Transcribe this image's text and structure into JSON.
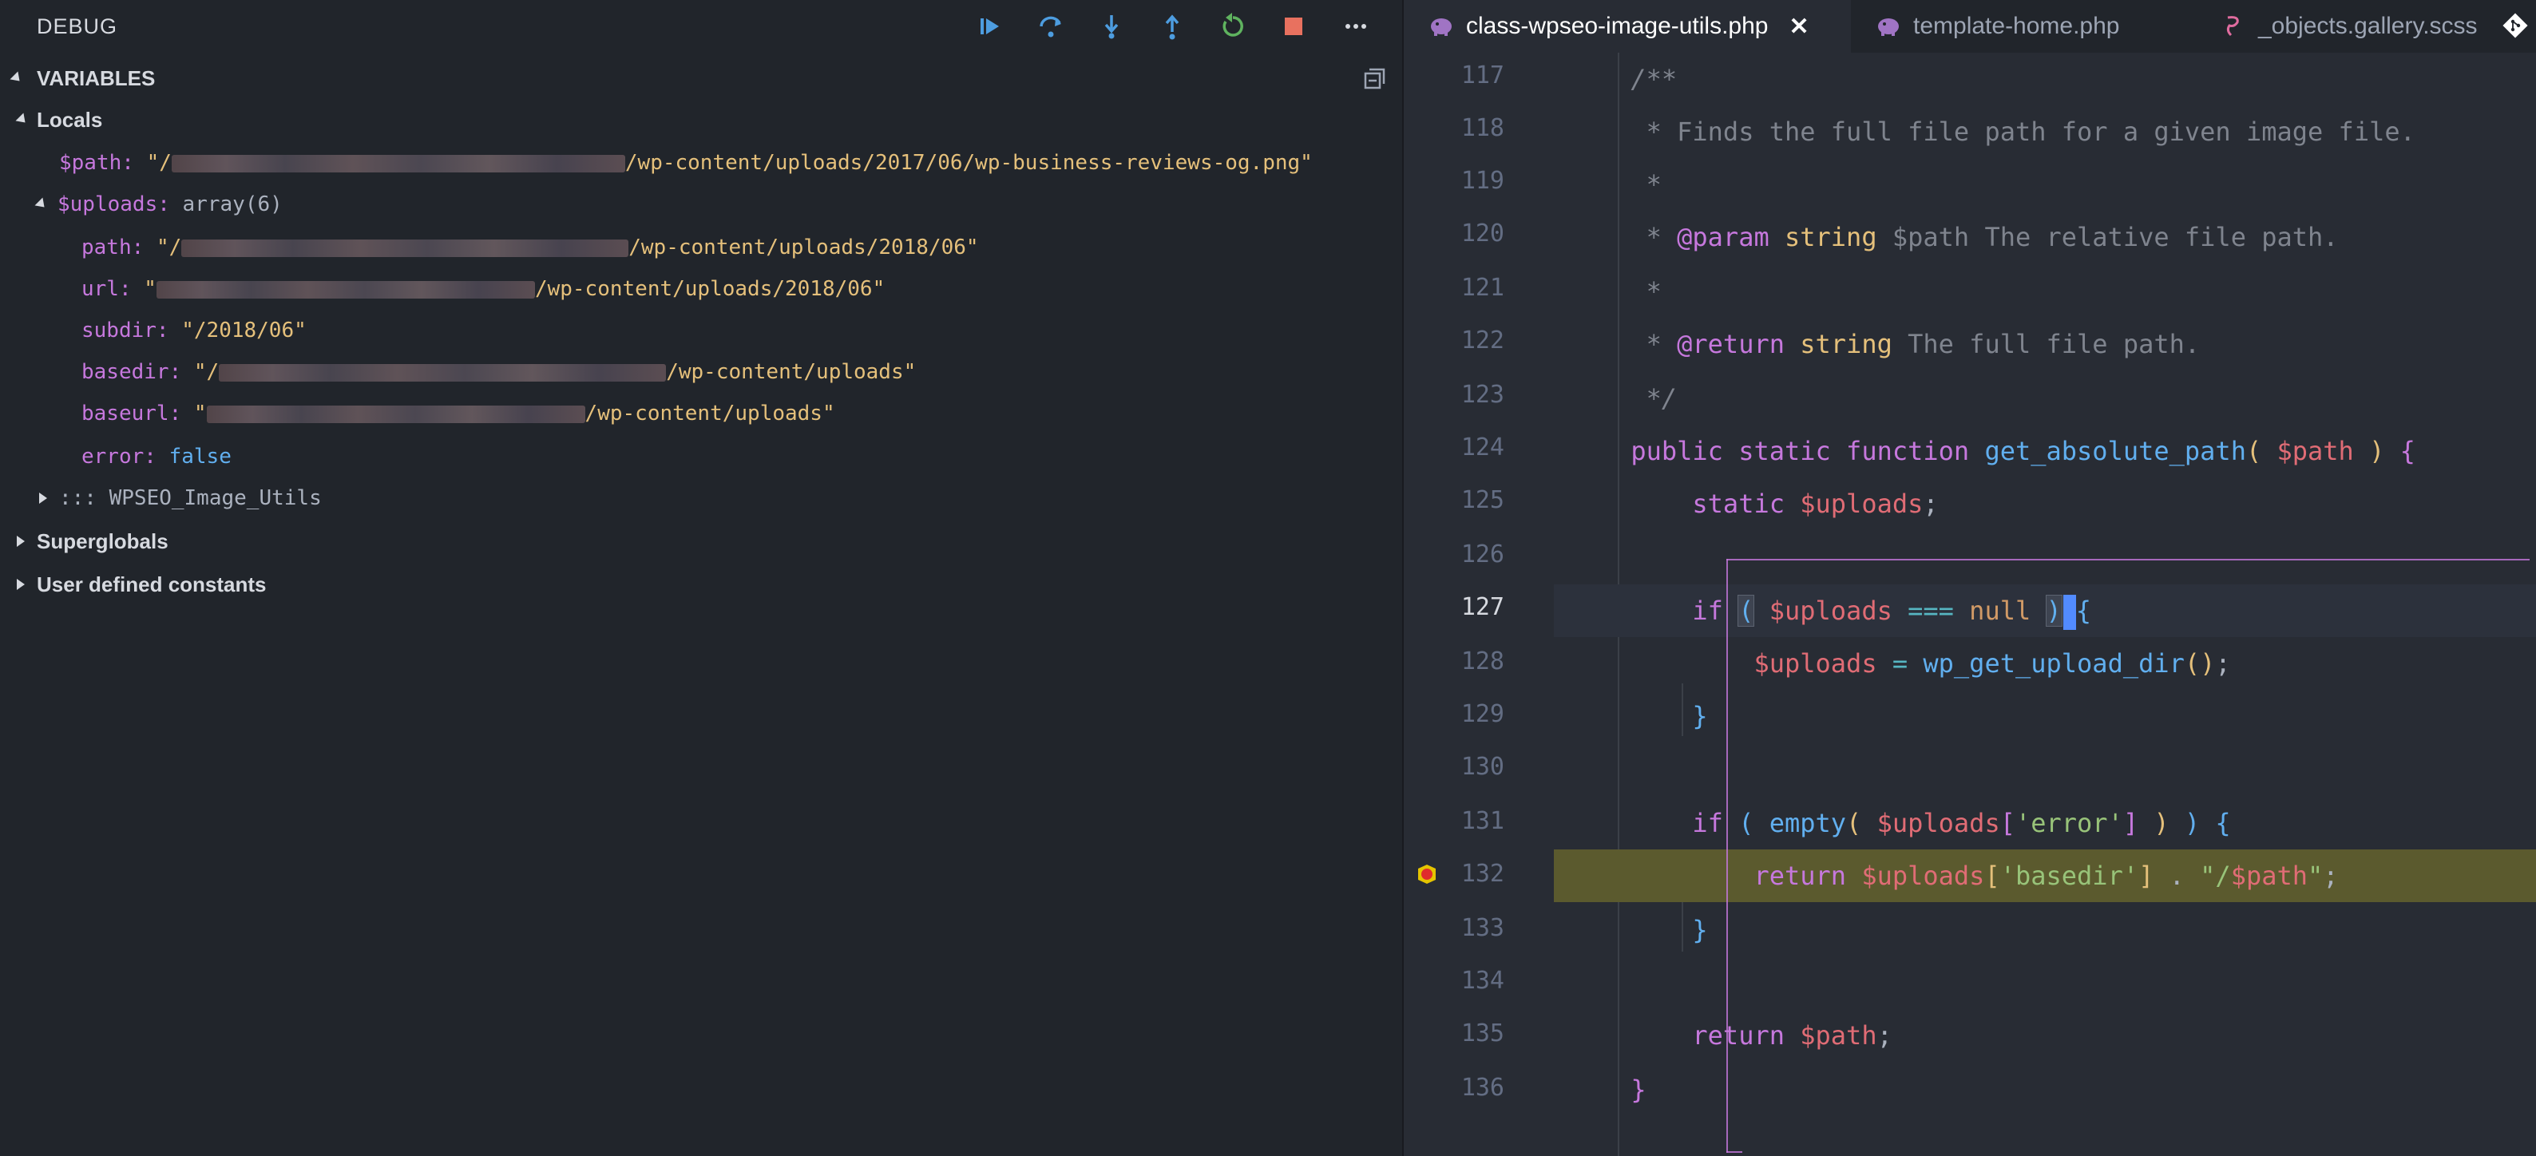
{
  "debug": {
    "title": "DEBUG",
    "toolbar_icons": [
      "continue-icon",
      "step-over-icon",
      "step-into-icon",
      "step-out-icon",
      "restart-icon",
      "stop-icon",
      "more-icon"
    ],
    "colors": {
      "continue": "#4d9de0",
      "step": "#4d9de0",
      "restart": "#5fb35f",
      "stop": "#e8715f"
    }
  },
  "variables": {
    "header": "VARIABLES",
    "locals_label": "Locals",
    "path_name": "$path:",
    "path_value_prefix": "\"/",
    "path_value_suffix": "/wp-content/uploads/2017/06/wp-business-reviews-og.png\"",
    "uploads_name": "$uploads:",
    "uploads_value": "array(6)",
    "uploads_children": [
      {
        "key": "path:",
        "prefix": "\"/",
        "suffix": "/wp-content/uploads/2018/06\""
      },
      {
        "key": "url:",
        "prefix": "\"",
        "suffix": "/wp-content/uploads/2018/06\""
      },
      {
        "key": "subdir:",
        "prefix": "",
        "suffix": "\"/2018/06\""
      },
      {
        "key": "basedir:",
        "prefix": "\"/",
        "suffix": "/wp-content/uploads\""
      },
      {
        "key": "baseurl:",
        "prefix": "\"",
        "suffix": "/wp-content/uploads\""
      },
      {
        "key": "error:",
        "prefix": "",
        "suffix": "false"
      }
    ],
    "class_row": "::: WPSEO_Image_Utils",
    "superglobals_label": "Superglobals",
    "constants_label": "User defined constants"
  },
  "tabs": [
    {
      "label": "class-wpseo-image-utils.php",
      "active": true,
      "close": "✕"
    },
    {
      "label": "template-home.php",
      "active": false
    },
    {
      "label": "_objects.gallery.scss",
      "active": false
    }
  ],
  "editor": {
    "line_numbers": [
      "117",
      "118",
      "119",
      "120",
      "121",
      "122",
      "123",
      "124",
      "125",
      "126",
      "127",
      "128",
      "129",
      "130",
      "131",
      "132",
      "133",
      "134",
      "135",
      "136"
    ],
    "current_line": "127",
    "breakpoint_line": "132",
    "lines": {
      "l117": "/**",
      "l118_star": "* ",
      "l118_text": "Finds the full file path for a given image file.",
      "l119": "*",
      "l120_star": "* ",
      "l120_tag": "@param",
      "l120_type": "string",
      "l120_var": "$path",
      "l120_text": "The relative file path.",
      "l121": "*",
      "l122_star": "* ",
      "l122_tag": "@return",
      "l122_type": "string",
      "l122_text": "The full file path.",
      "l123": "*/",
      "l124_kw1": "public",
      "l124_kw2": "static",
      "l124_kw3": "function",
      "l124_fn": "get_absolute_path",
      "l124_open": "(",
      "l124_var": "$path",
      "l124_close": ")",
      "l124_brace": "{",
      "l125_kw": "static",
      "l125_var": "$uploads",
      "l125_semi": ";",
      "l127_kw": "if",
      "l127_open": "(",
      "l127_var": "$uploads",
      "l127_op": "===",
      "l127_null": "null",
      "l127_close": ")",
      "l127_brace": "{",
      "l128_var": "$uploads",
      "l128_eq": "=",
      "l128_fn": "wp_get_upload_dir",
      "l128_parens": "()",
      "l128_semi": ";",
      "l129": "}",
      "l131_kw": "if",
      "l131_open": "(",
      "l131_fn": "empty",
      "l131_open2": "(",
      "l131_var": "$uploads",
      "l131_bopen": "[",
      "l131_str": "'error'",
      "l131_bclose": "]",
      "l131_close2": ")",
      "l131_close": ")",
      "l131_brace": "{",
      "l132_kw": "return",
      "l132_var": "$uploads",
      "l132_bopen": "[",
      "l132_str": "'basedir'",
      "l132_bclose": "]",
      "l132_dot": ".",
      "l132_q1": "\"/",
      "l132_var2": "$path",
      "l132_q2": "\"",
      "l132_semi": ";",
      "l133": "}",
      "l135_kw": "return",
      "l135_var": "$path",
      "l135_semi": ";",
      "l136": "}"
    }
  }
}
